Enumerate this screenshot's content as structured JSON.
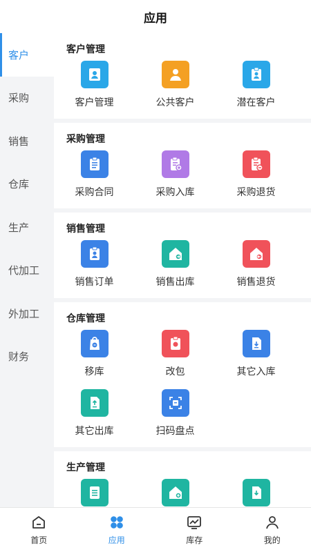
{
  "header": {
    "title": "应用"
  },
  "sidebar": {
    "items": [
      {
        "label": "客户",
        "active": true
      },
      {
        "label": "采购"
      },
      {
        "label": "销售"
      },
      {
        "label": "仓库"
      },
      {
        "label": "生产"
      },
      {
        "label": "代加工"
      },
      {
        "label": "外加工"
      },
      {
        "label": "财务"
      }
    ]
  },
  "sections": [
    {
      "title": "客户管理",
      "items": [
        {
          "label": "客户管理",
          "icon": "contact-icon",
          "color": "#2aa7e8"
        },
        {
          "label": "公共客户",
          "icon": "user-icon",
          "color": "#f4a023"
        },
        {
          "label": "潜在客户",
          "icon": "clipboard-user-icon",
          "color": "#2aa7e8"
        }
      ]
    },
    {
      "title": "采购管理",
      "items": [
        {
          "label": "采购合同",
          "icon": "contract-icon",
          "color": "#3b82e6"
        },
        {
          "label": "采购入库",
          "icon": "clipboard-in-icon",
          "color": "#b07ae6"
        },
        {
          "label": "采购退货",
          "icon": "clipboard-return-icon",
          "color": "#f0525a"
        }
      ]
    },
    {
      "title": "销售管理",
      "items": [
        {
          "label": "销售订单",
          "icon": "order-icon",
          "color": "#3b82e6"
        },
        {
          "label": "销售出库",
          "icon": "house-out-icon",
          "color": "#1fb5a1"
        },
        {
          "label": "销售退货",
          "icon": "house-return-icon",
          "color": "#f0525a"
        }
      ]
    },
    {
      "title": "仓库管理",
      "items": [
        {
          "label": "移库",
          "icon": "transfer-icon",
          "color": "#3b82e6"
        },
        {
          "label": "改包",
          "icon": "repack-icon",
          "color": "#f0525a"
        },
        {
          "label": "其它入库",
          "icon": "doc-in-icon",
          "color": "#3b82e6"
        },
        {
          "label": "其它出库",
          "icon": "doc-out-icon",
          "color": "#1fb5a1"
        },
        {
          "label": "扫码盘点",
          "icon": "scan-icon",
          "color": "#3b82e6"
        }
      ]
    },
    {
      "title": "生产管理",
      "items": [
        {
          "label": "",
          "icon": "list-doc-icon",
          "color": "#1fb5a1"
        },
        {
          "label": "",
          "icon": "house-add-icon",
          "color": "#1fb5a1"
        },
        {
          "label": "",
          "icon": "doc-down-icon",
          "color": "#1fb5a1"
        }
      ]
    }
  ],
  "tabbar": {
    "items": [
      {
        "label": "首页",
        "icon": "home-icon"
      },
      {
        "label": "应用",
        "icon": "apps-icon",
        "active": true
      },
      {
        "label": "库存",
        "icon": "chart-icon"
      },
      {
        "label": "我的",
        "icon": "person-icon"
      }
    ]
  },
  "colors": {
    "accent": "#2f8fe8",
    "sidebar_bg": "#f3f4f6"
  }
}
